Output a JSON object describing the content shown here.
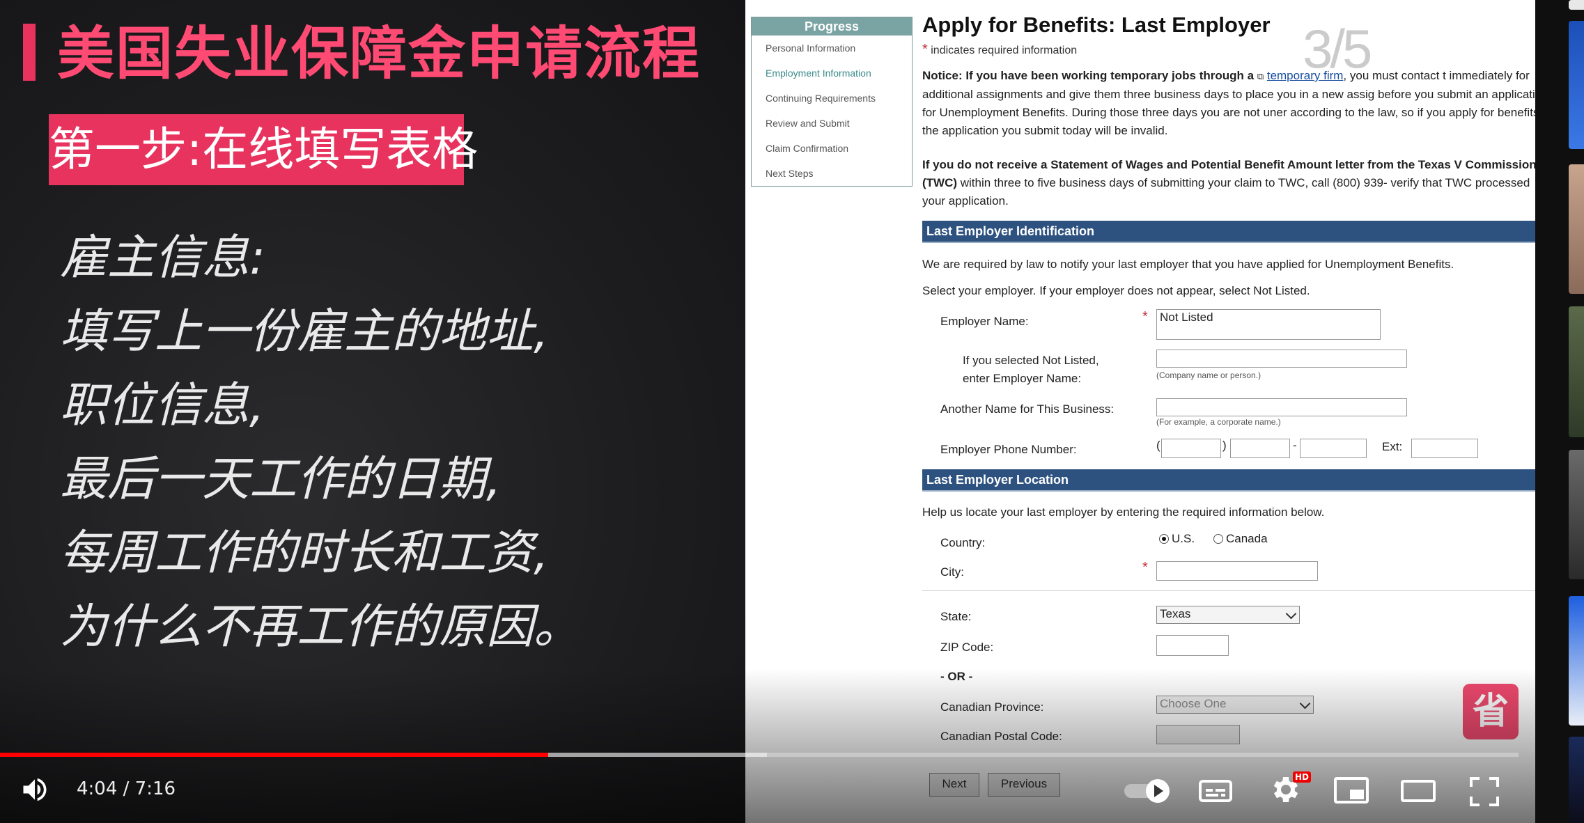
{
  "slide": {
    "title": "美国失业保障金申请流程",
    "step_badge": "第一步:在线填写表格",
    "lines": [
      "雇主信息:",
      "填写上一份雇主的地址,",
      "职位信息,",
      "最后一天工作的日期,",
      "每周工作的时长和工资,",
      "为什么不再工作的原因。"
    ]
  },
  "form": {
    "progress_title": "Progress",
    "progress_items": [
      "Personal Information",
      "Employment Information",
      "Continuing Requirements",
      "Review and Submit",
      "Claim Confirmation",
      "Next Steps"
    ],
    "page_title": "Apply for Benefits: Last Employer",
    "page_counter": "3/5",
    "required_note": "indicates required information",
    "notice_lead": "Notice: If you have been working temporary jobs through a",
    "notice_link": "temporary firm",
    "notice_rest": ", you must contact t immediately for additional assignments and give them three business days to place you in a new assig before you submit an application for Unemployment Benefits. During those three days you are not uner according to the law, so if you apply for benefits, the application you submit today will be invalid.",
    "notice2_bold": "If you do not receive a Statement of Wages and Potential Benefit Amount letter from the Texas V Commission (TWC)",
    "notice2_rest": " within three to five business days of submitting your claim to TWC, call (800) 939- verify that TWC processed your application.",
    "section1_title": "Last Employer Identification",
    "section1_text1": "We are required by law to notify your last employer that you have applied for Unemployment Benefits.",
    "section1_text2": "Select your employer. If your employer does not appear, select Not Listed.",
    "employer_name_label": "Employer Name:",
    "employer_name_value": "Not Listed",
    "not_listed_label_1": "If you selected Not Listed,",
    "not_listed_label_2": "enter Employer Name:",
    "not_listed_hint": "(Company name or person.)",
    "another_name_label": "Another Name for This Business:",
    "another_name_hint": "(For example, a corporate name.)",
    "phone_label": "Employer Phone Number:",
    "ext_label": "Ext:",
    "section2_title": "Last Employer Location",
    "section2_text": "Help us locate your last employer by entering the required information below.",
    "country_label": "Country:",
    "country_us": "U.S.",
    "country_canada": "Canada",
    "city_label": "City:",
    "state_label": "State:",
    "state_value": "Texas",
    "zip_label": "ZIP Code:",
    "or_label": "- OR -",
    "province_label": "Canadian Province:",
    "province_value": "Choose One",
    "postal_label": "Canadian Postal Code:",
    "next_button": "Next",
    "previous_button": "Previous"
  },
  "player": {
    "time_current": "4:04",
    "time_total": "7:16",
    "time_display": "4:04 / 7:16",
    "progress_played": 0.3612,
    "progress_buffered": 0.505,
    "hd_badge": "HD",
    "save_badge": "省",
    "colors": {
      "played": "#ff0000",
      "accent_pink": "#e8335f"
    }
  },
  "icons": [
    "volume-icon",
    "autoplay-toggle-icon",
    "subtitles-icon",
    "settings-gear-icon",
    "miniplayer-icon",
    "theater-mode-icon",
    "fullscreen-icon"
  ]
}
